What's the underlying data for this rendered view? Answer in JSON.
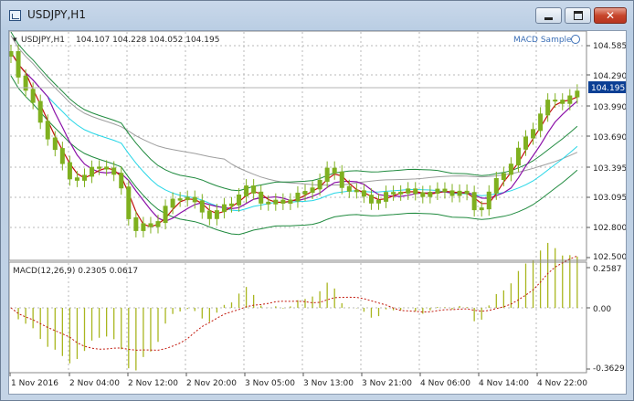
{
  "window": {
    "title": "USDJPY,H1",
    "minimize_glyph": "",
    "maximize_glyph": "",
    "close_glyph": "✕"
  },
  "main_chart": {
    "symbol_label": "USDJPY,H1",
    "ohlc_text": "104.107 104.228 104.052 104.195",
    "expert_label": "MACD Sample",
    "expert_icon": "smiley-icon",
    "price_ticks": [
      "104.585",
      "104.290",
      "103.990",
      "103.690",
      "103.395",
      "103.095",
      "102.800",
      "102.500"
    ],
    "bid_label": "104.195",
    "bid_color": "#0b3f94"
  },
  "sub_chart": {
    "indicator_label": "MACD(12,26,9) 0.2305 0.0617",
    "ticks": [
      "0.2587",
      "0.00",
      "-0.3629"
    ]
  },
  "time_axis": {
    "labels": [
      "1 Nov 2016",
      "2 Nov 04:00",
      "2 Nov 12:00",
      "2 Nov 20:00",
      "3 Nov 05:00",
      "3 Nov 13:00",
      "3 Nov 21:00",
      "4 Nov 06:00",
      "4 Nov 14:00",
      "4 Nov 22:00"
    ]
  },
  "colors": {
    "candle": "#7fb01f",
    "macd_hist": "#a9b61f",
    "signal": "#c2180c",
    "ma_fast": "#c0100c",
    "ma_mid": "#8b10a8",
    "ma_cyan": "#25d6e6",
    "ma_slow": "#9e9e9e",
    "bands": "#1f8a3e",
    "grid": "#b8b8b8"
  }
}
